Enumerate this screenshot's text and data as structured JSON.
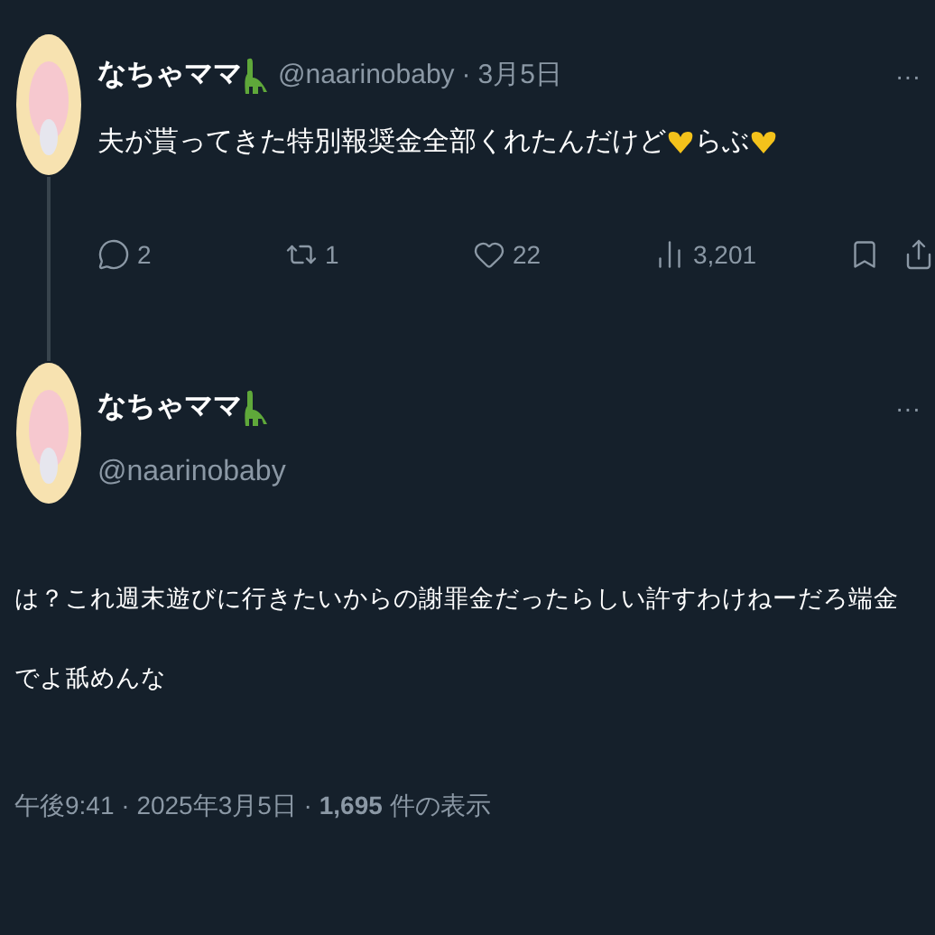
{
  "reply_tweet": {
    "name": "なちゃママ",
    "handle": "@naarinobaby",
    "separator": "·",
    "date": "3月5日",
    "more": "···",
    "text_before": "夫が貰ってきた特別報奨金全部くれたんだけど",
    "text_middle": "らぶ",
    "actions": [
      {
        "kind": "reply",
        "count": "2"
      },
      {
        "kind": "repost",
        "count": "1"
      },
      {
        "kind": "like",
        "count": "22"
      },
      {
        "kind": "views",
        "count": "3,201"
      }
    ]
  },
  "main_tweet": {
    "name": "なちゃママ",
    "handle": "@naarinobaby",
    "more": "···",
    "text": "は？これ週末遊びに行きたいからの謝罪金だったらしい許すわけねーだろ端金でよ舐めんな",
    "meta": "午後9:41 · 2025年3月5日 · **1,695** 件の表示"
  }
}
